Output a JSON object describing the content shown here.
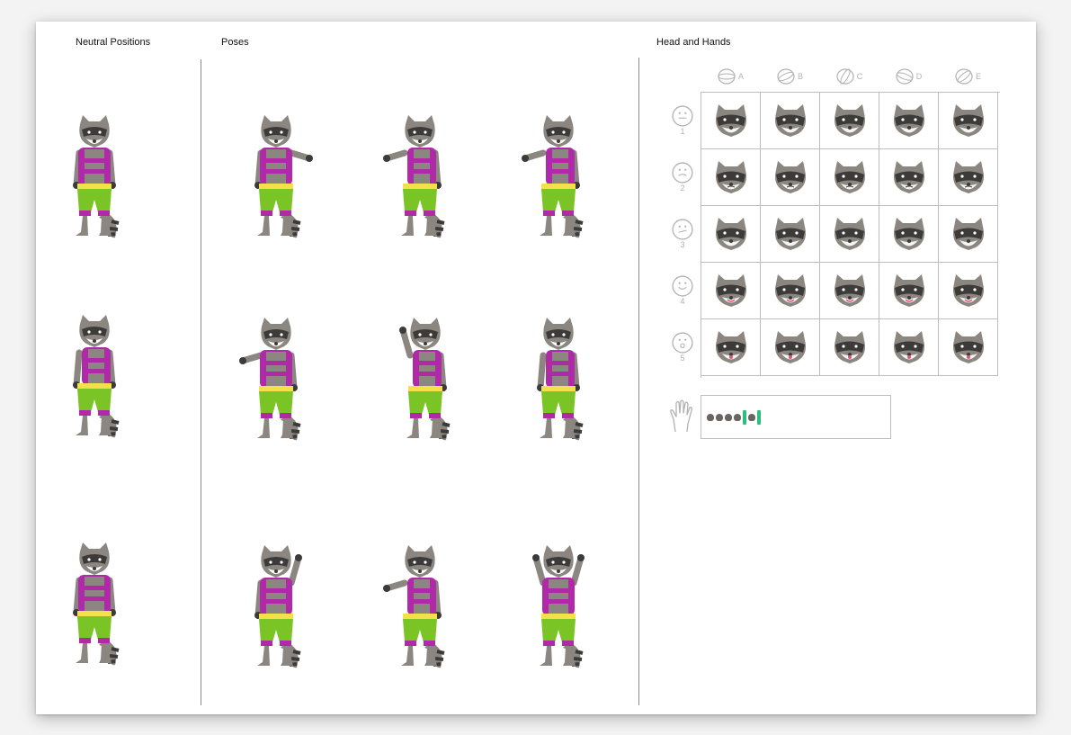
{
  "sections": {
    "neutral": "Neutral Positions",
    "poses": "Poses",
    "head_hands": "Head and Hands"
  },
  "column_labels": [
    "A",
    "B",
    "C",
    "D",
    "E"
  ],
  "row_labels": [
    "1",
    "2",
    "3",
    "4",
    "5"
  ],
  "colors": {
    "fur": "#8c8680",
    "fur_dark": "#3d3a3a",
    "vest": "#b02aa8",
    "belt": "#f2e14a",
    "pants": "#7bc425",
    "cuffs": "#b02aa8",
    "grid": "#bdbdbd",
    "icon": "#b2b2b2",
    "accent": "#2bbf7a"
  },
  "icons": {
    "column": "head-angle-icon",
    "row": "face-expression-icon",
    "hand": "hand-icon"
  }
}
